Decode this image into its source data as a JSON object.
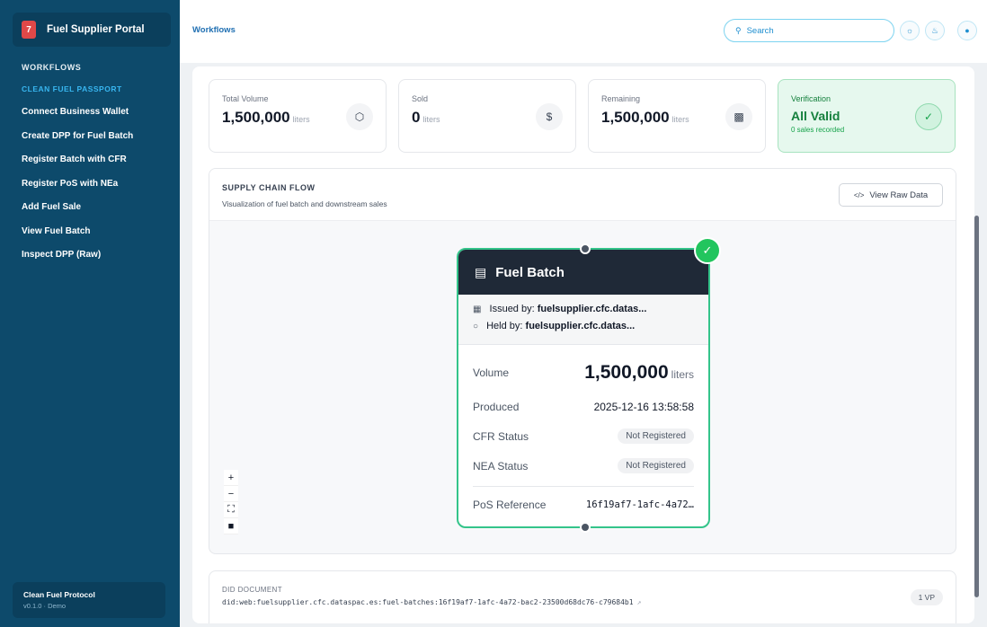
{
  "sidebar": {
    "brand_logo": "7",
    "brand_name": "Fuel Supplier Portal",
    "section_heading": "WORKFLOWS",
    "section_sub": "CLEAN FUEL PASSPORT",
    "items": [
      {
        "label": "Connect Business Wallet"
      },
      {
        "label": "Create DPP for Fuel Batch"
      },
      {
        "label": "Register Batch with CFR"
      },
      {
        "label": "Register PoS with NEa"
      },
      {
        "label": "Add Fuel Sale"
      },
      {
        "label": "View Fuel Batch"
      },
      {
        "label": "Inspect DPP (Raw)"
      }
    ],
    "footer": {
      "title": "Clean Fuel Protocol",
      "version": "v0.1.0 · Demo"
    }
  },
  "header": {
    "breadcrumb": "Workflows",
    "search_placeholder": "Search",
    "search_icon": "search-icon",
    "buttons": [
      "sun-icon",
      "bell-icon",
      "user-icon"
    ]
  },
  "stats": {
    "total": {
      "label": "Total Volume",
      "value": "1,500,000",
      "unit": "liters",
      "icon": "cube-icon"
    },
    "sold": {
      "label": "Sold",
      "value": "0",
      "unit": "liters",
      "icon": "dollar-icon"
    },
    "remaining": {
      "label": "Remaining",
      "value": "1,500,000",
      "unit": "liters",
      "icon": "bar-chart-icon"
    },
    "verification": {
      "label": "Verification",
      "value": "All Valid",
      "sub": "0 sales recorded",
      "icon": "check-circle-icon"
    }
  },
  "flow": {
    "title": "SUPPLY CHAIN FLOW",
    "subtitle": "Visualization of fuel batch and downstream sales",
    "raw_button": "View Raw Data",
    "node": {
      "title": "Fuel Batch",
      "issued_label": "Issued by:",
      "issued_value": "fuelsupplier.cfc.datas...",
      "held_label": "Held by:",
      "held_value": "fuelsupplier.cfc.datas...",
      "volume_label": "Volume",
      "volume_value": "1,500,000",
      "volume_unit": "liters",
      "produced_label": "Produced",
      "produced_value": "2025-12-16 13:58:58",
      "cfr_label": "CFR Status",
      "cfr_value": "Not Registered",
      "nea_label": "NEA Status",
      "nea_value": "Not Registered",
      "pos_label": "PoS Reference",
      "pos_value": "16f19af7-1afc-4a72…"
    },
    "controls": [
      "+",
      "−",
      "⛶",
      "🔒"
    ]
  },
  "did": {
    "label": "DID DOCUMENT",
    "value": "did:web:fuelsupplier.cfc.dataspac.es:fuel-batches:16f19af7-1afc-4a72-bac2-23500d68dc76-c79684b1",
    "badge": "1 VP"
  },
  "colors": {
    "sidebar": "#0d4a6b",
    "accent": "#38b6f0",
    "success": "#22c55e",
    "node_border": "#34c48a"
  }
}
